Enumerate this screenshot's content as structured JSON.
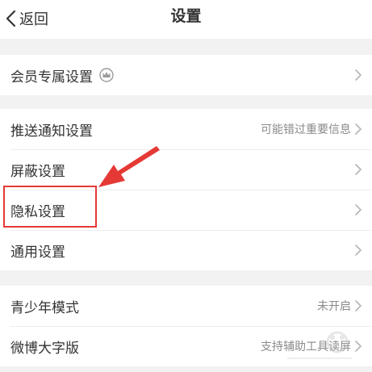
{
  "nav": {
    "back_label": "返回",
    "title": "设置"
  },
  "groups": [
    {
      "rows": [
        {
          "label": "会员专属设置",
          "value": "",
          "badge_icon": "crown-icon"
        }
      ]
    },
    {
      "rows": [
        {
          "label": "推送通知设置",
          "value": "可能错过重要信息"
        },
        {
          "label": "屏蔽设置",
          "value": ""
        },
        {
          "label": "隐私设置",
          "value": ""
        },
        {
          "label": "通用设置",
          "value": ""
        }
      ]
    },
    {
      "rows": [
        {
          "label": "青少年模式",
          "value": "未开启"
        },
        {
          "label": "微博大字版",
          "value": "支持辅助工具读屏"
        }
      ]
    }
  ],
  "annotation": {
    "highlight_color": "#e53935",
    "highlighted_row": "隐私设置"
  },
  "colors": {
    "background": "#f2f2f2",
    "row_background": "#ffffff",
    "text": "#333333",
    "secondary_text": "#8a8a8a"
  }
}
